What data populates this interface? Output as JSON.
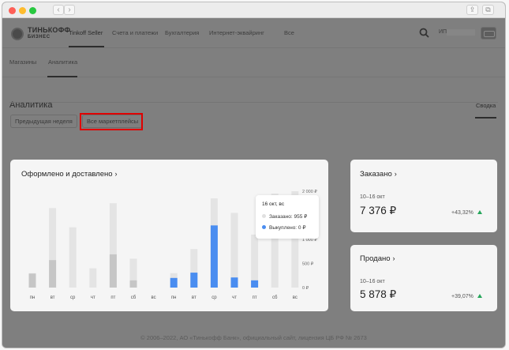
{
  "browser": {
    "traffic_lights": [
      "#fe5f57",
      "#febc2e",
      "#28c840"
    ],
    "back_glyph": "‹",
    "forward_glyph": "›",
    "share_glyph": "⇪",
    "tabs_glyph": "⧉"
  },
  "header": {
    "logo_line1": "ТИНЬКОФФ",
    "logo_line2": "БИЗНЕС",
    "nav": [
      "Tinkoff Seller",
      "Счета и платежи",
      "Бухгалтерия",
      "Интернет-эквайринг",
      "Все"
    ],
    "active_nav_index": 0,
    "user_prefix": "ИП"
  },
  "subnav": {
    "items": [
      "Магазины",
      "Аналитика"
    ],
    "active_index": 1
  },
  "page": {
    "title": "Аналитика",
    "right_tab": "Сводка"
  },
  "filters": {
    "period": "Предыдущая неделя",
    "marketplaces": "Все маркетплейсы"
  },
  "chart_card": {
    "title": "Оформлено и доставлено",
    "tooltip": {
      "title": "16 окт, вс",
      "ordered_label": "Заказано: 955 ₽",
      "bought_label": "Выкуплено: 0 ₽"
    }
  },
  "chart_data": {
    "type": "bar",
    "categories": [
      "пн",
      "вт",
      "ср",
      "чт",
      "пт",
      "сб",
      "вс",
      "пн",
      "вт",
      "ср",
      "чт",
      "пт",
      "сб",
      "вс"
    ],
    "series": [
      {
        "values": [
          300,
          1650,
          1250,
          400,
          1750,
          600,
          0,
          300,
          800,
          1850,
          1550,
          1100,
          1950,
          2000
        ]
      },
      {
        "values": [
          290,
          570,
          0,
          0,
          690,
          150,
          0,
          200,
          310,
          1290,
          210,
          150,
          0,
          0
        ]
      }
    ],
    "y_ticks": [
      "2 000 ₽",
      "1 500 ₽",
      "1 000 ₽",
      "500 ₽",
      "0 ₽"
    ],
    "ylim": [
      0,
      2000
    ],
    "grid": false,
    "colors": {
      "bg_bar": "#e4e4e4",
      "bg_bar_first_week_sold": "#c6c6c6",
      "sold_bar_second_week": "#4a8df0"
    }
  },
  "metrics": [
    {
      "title": "Заказано",
      "subtitle": "10–16 окт",
      "value": "7 376 ₽",
      "change": "+43,32%"
    },
    {
      "title": "Продано",
      "subtitle": "10–16 окт",
      "value": "5 878 ₽",
      "change": "+39,07%"
    }
  ],
  "footer": "© 2006–2022, АО «Тинькофф Банк», официальный сайт, лицензия ЦБ РФ № 2673"
}
